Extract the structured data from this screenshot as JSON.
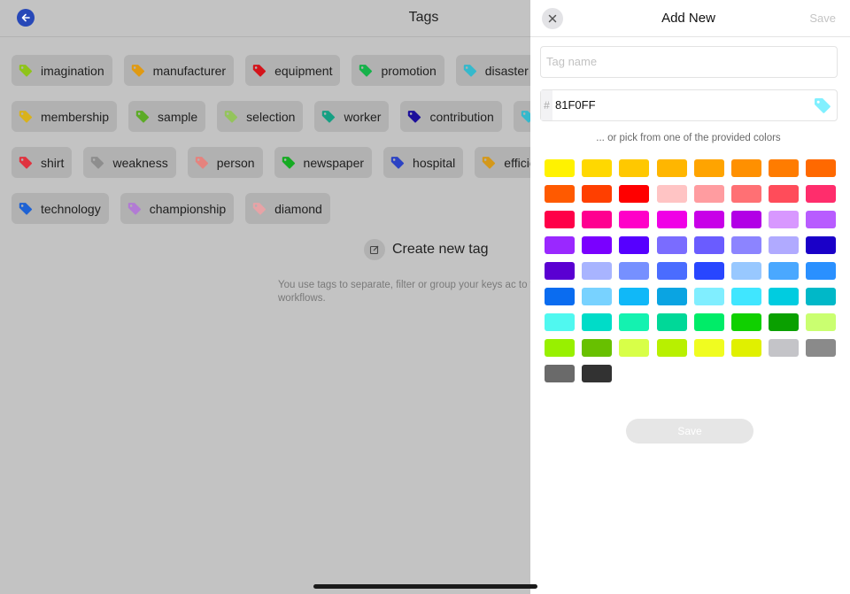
{
  "left": {
    "title": "Tags",
    "tag_rows": [
      [
        {
          "label": "imagination",
          "color": "#8fc41a"
        },
        {
          "label": "manufacturer",
          "color": "#e09a12"
        },
        {
          "label": "equipment",
          "color": "#d4141b"
        },
        {
          "label": "promotion",
          "color": "#16b24a"
        },
        {
          "label": "disaster",
          "color": "#35b9cc"
        }
      ],
      [
        {
          "label": "membership",
          "color": "#d9b21b"
        },
        {
          "label": "sample",
          "color": "#5cab26"
        },
        {
          "label": "selection",
          "color": "#94c45c"
        },
        {
          "label": "worker",
          "color": "#16a083"
        },
        {
          "label": "contribution",
          "color": "#1c0f9b"
        },
        {
          "label": "",
          "color": "#35b9cc"
        }
      ],
      [
        {
          "label": "shirt",
          "color": "#e0333f"
        },
        {
          "label": "weakness",
          "color": "#8e8e8e"
        },
        {
          "label": "person",
          "color": "#e5837e"
        },
        {
          "label": "newspaper",
          "color": "#16ab23"
        },
        {
          "label": "hospital",
          "color": "#2c43c4"
        },
        {
          "label": "efficien",
          "color": "#d4981a"
        }
      ],
      [
        {
          "label": "technology",
          "color": "#1e62d4"
        },
        {
          "label": "championship",
          "color": "#b27bd4"
        },
        {
          "label": "diamond",
          "color": "#e7a3a6"
        }
      ]
    ],
    "create_label": "Create new tag",
    "help_text": "You use tags to separate, filter or group your keys ac to your workflows."
  },
  "panel": {
    "title": "Add New",
    "save_label": "Save",
    "tag_name_placeholder": "Tag name",
    "hash": "#",
    "hex_value": "81F0FF",
    "preview_color": "#81F0FF",
    "pick_text": "... or pick from one of the provided colors",
    "bottom_save_label": "Save",
    "swatches": [
      [
        "#fff200",
        "#ffd800",
        "#ffc800",
        "#ffb600",
        "#ffa400",
        "#ff9000",
        "#ff7c00",
        "#ff6900"
      ],
      [
        "#ff5a00",
        "#ff3f00",
        "#ff0000",
        "#ffc4c4",
        "#ff9ca0",
        "#ff7074",
        "#ff4c5a",
        "#ff2d6c"
      ],
      [
        "#ff0048",
        "#ff0090",
        "#ff00c8",
        "#f000e6",
        "#c800e8",
        "#b200e6",
        "#d898ff",
        "#b85cff"
      ],
      [
        "#9a28ff",
        "#7a00ff",
        "#5600ff",
        "#7a6cff",
        "#6a5cff",
        "#8c84ff",
        "#b0aaff",
        "#1a00c8"
      ],
      [
        "#5a00d2",
        "#a8b4ff",
        "#7690ff",
        "#4a6cff",
        "#2846ff",
        "#98c8ff",
        "#4aa8ff",
        "#2a90ff"
      ],
      [
        "#0a6cf0",
        "#78d2ff",
        "#10b8f8",
        "#0aa4e2",
        "#80eeff",
        "#40e6ff",
        "#00cce0",
        "#00b8c8"
      ],
      [
        "#50f8f0",
        "#00dcc8",
        "#14f2b0",
        "#00d898",
        "#00ec68",
        "#10d000",
        "#0aa000",
        "#caff70"
      ],
      [
        "#98f000",
        "#68c000",
        "#d8ff48",
        "#b8f000",
        "#f0fc20",
        "#e0f000",
        "#c4c4c8",
        "#8a8a8a"
      ],
      [
        "#6a6a6a",
        "#323232"
      ]
    ]
  }
}
